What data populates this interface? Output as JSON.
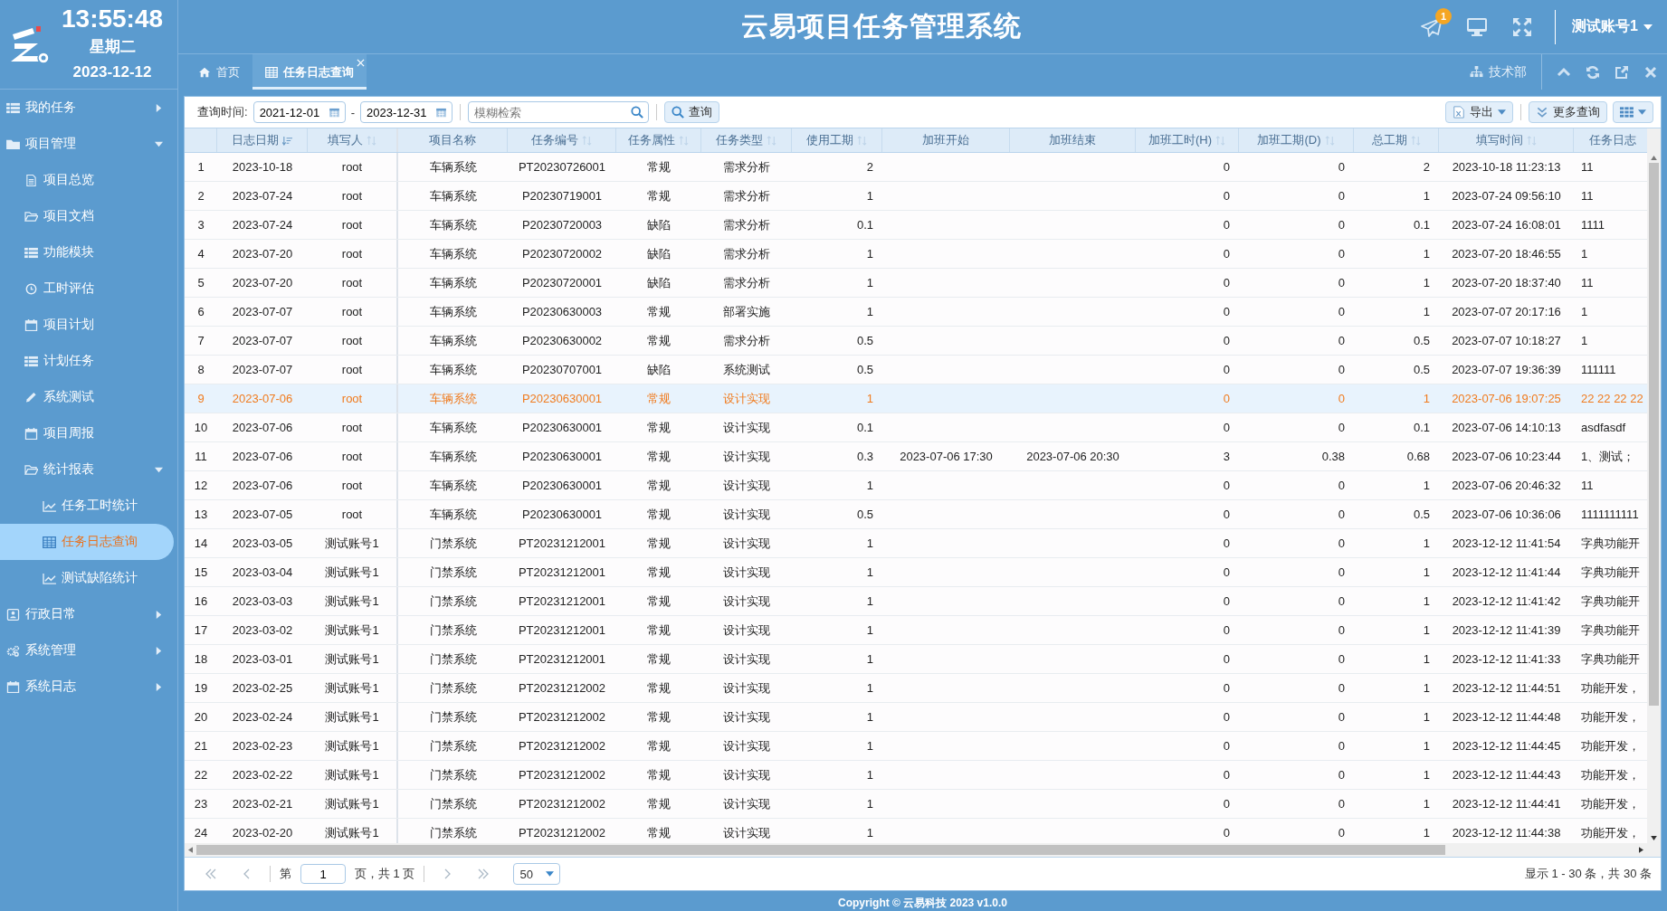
{
  "header": {
    "time": "13:55:48",
    "weekday": "星期二",
    "date": "2023-12-12",
    "title": "云易项目任务管理系统",
    "notification_count": "1",
    "user": "测试账号1"
  },
  "sidebar": {
    "items": [
      {
        "label": "我的任务",
        "expanded": false
      },
      {
        "label": "项目管理",
        "expanded": true,
        "children": [
          {
            "label": "项目总览",
            "selected": false
          },
          {
            "label": "项目文档",
            "selected": false
          },
          {
            "label": "功能模块",
            "selected": false
          },
          {
            "label": "工时评估",
            "selected": false
          },
          {
            "label": "项目计划",
            "selected": false
          },
          {
            "label": "计划任务",
            "selected": false
          },
          {
            "label": "系统测试",
            "selected": false
          },
          {
            "label": "项目周报",
            "selected": false
          },
          {
            "label": "统计报表",
            "expanded": true,
            "children": [
              {
                "label": "任务工时统计",
                "selected": false
              },
              {
                "label": "任务日志查询",
                "selected": true
              },
              {
                "label": "测试缺陷统计",
                "selected": false
              }
            ]
          }
        ]
      },
      {
        "label": "行政日常",
        "expanded": false
      },
      {
        "label": "系统管理",
        "expanded": false
      },
      {
        "label": "系统日志",
        "expanded": false
      }
    ]
  },
  "tabs": [
    {
      "label": "首页",
      "selected": false,
      "closable": false
    },
    {
      "label": "任务日志查询",
      "selected": true,
      "closable": true
    }
  ],
  "department": "技术部",
  "toolbar": {
    "time_label": "查询时间:",
    "date_from": "2021-12-01",
    "separator": "-",
    "date_to": "2023-12-31",
    "search_placeholder": "模糊检索",
    "search_button": "查询",
    "export_button": "导出",
    "more_button": "更多查询"
  },
  "table": {
    "columns": [
      {
        "sortable": false,
        "sorted": false
      },
      {
        "label": "日志日期",
        "sortable": true,
        "sorted": true
      },
      {
        "label": "填写人",
        "sortable": true,
        "sorted": false
      },
      {
        "label": "项目名称",
        "sortable": false,
        "sorted": false
      },
      {
        "label": "任务编号",
        "sortable": true,
        "sorted": false
      },
      {
        "label": "任务属性",
        "sortable": true,
        "sorted": false
      },
      {
        "label": "任务类型",
        "sortable": true,
        "sorted": false
      },
      {
        "label": "使用工期",
        "sortable": true,
        "sorted": false
      },
      {
        "label": "加班开始",
        "sortable": false,
        "sorted": false
      },
      {
        "label": "加班结束",
        "sortable": false,
        "sorted": false
      },
      {
        "label": "加班工时(H)",
        "sortable": true,
        "sorted": false
      },
      {
        "label": "加班工期(D)",
        "sortable": true,
        "sorted": false
      },
      {
        "label": "总工期",
        "sortable": true,
        "sorted": false
      },
      {
        "label": "填写时间",
        "sortable": true,
        "sorted": false
      },
      {
        "label": "任务日志",
        "sortable": false,
        "sorted": false
      }
    ],
    "rows": [
      {
        "selected": false,
        "cells": [
          "1",
          "2023-10-18",
          "root",
          "车辆系统",
          "PT20230726001",
          "常规",
          "需求分析",
          "2",
          "",
          "",
          "0",
          "0",
          "2",
          "2023-10-18 11:23:13",
          "11"
        ]
      },
      {
        "selected": false,
        "cells": [
          "2",
          "2023-07-24",
          "root",
          "车辆系统",
          "P20230719001",
          "常规",
          "需求分析",
          "1",
          "",
          "",
          "0",
          "0",
          "1",
          "2023-07-24 09:56:10",
          "11"
        ]
      },
      {
        "selected": false,
        "cells": [
          "3",
          "2023-07-24",
          "root",
          "车辆系统",
          "P20230720003",
          "缺陷",
          "需求分析",
          "0.1",
          "",
          "",
          "0",
          "0",
          "0.1",
          "2023-07-24 16:08:01",
          "1111"
        ]
      },
      {
        "selected": false,
        "cells": [
          "4",
          "2023-07-20",
          "root",
          "车辆系统",
          "P20230720002",
          "缺陷",
          "需求分析",
          "1",
          "",
          "",
          "0",
          "0",
          "1",
          "2023-07-20 18:46:55",
          "1"
        ]
      },
      {
        "selected": false,
        "cells": [
          "5",
          "2023-07-20",
          "root",
          "车辆系统",
          "P20230720001",
          "缺陷",
          "需求分析",
          "1",
          "",
          "",
          "0",
          "0",
          "1",
          "2023-07-20 18:37:40",
          "11"
        ]
      },
      {
        "selected": false,
        "cells": [
          "6",
          "2023-07-07",
          "root",
          "车辆系统",
          "P20230630003",
          "常规",
          "部署实施",
          "1",
          "",
          "",
          "0",
          "0",
          "1",
          "2023-07-07 20:17:16",
          "1"
        ]
      },
      {
        "selected": false,
        "cells": [
          "7",
          "2023-07-07",
          "root",
          "车辆系统",
          "P20230630002",
          "常规",
          "需求分析",
          "0.5",
          "",
          "",
          "0",
          "0",
          "0.5",
          "2023-07-07 10:18:27",
          "1"
        ]
      },
      {
        "selected": false,
        "cells": [
          "8",
          "2023-07-07",
          "root",
          "车辆系统",
          "P20230707001",
          "缺陷",
          "系统测试",
          "0.5",
          "",
          "",
          "0",
          "0",
          "0.5",
          "2023-07-07 19:36:39",
          "111111"
        ]
      },
      {
        "selected": true,
        "cells": [
          "9",
          "2023-07-06",
          "root",
          "车辆系统",
          "P20230630001",
          "常规",
          "设计实现",
          "1",
          "",
          "",
          "0",
          "0",
          "1",
          "2023-07-06 19:07:25",
          "22 22 22 22"
        ]
      },
      {
        "selected": false,
        "cells": [
          "10",
          "2023-07-06",
          "root",
          "车辆系统",
          "P20230630001",
          "常规",
          "设计实现",
          "0.1",
          "",
          "",
          "0",
          "0",
          "0.1",
          "2023-07-06 14:10:13",
          "asdfasdf"
        ]
      },
      {
        "selected": false,
        "cells": [
          "11",
          "2023-07-06",
          "root",
          "车辆系统",
          "P20230630001",
          "常规",
          "设计实现",
          "0.3",
          "2023-07-06 17:30",
          "2023-07-06 20:30",
          "3",
          "0.38",
          "0.68",
          "2023-07-06 10:23:44",
          "1、测试；"
        ]
      },
      {
        "selected": false,
        "cells": [
          "12",
          "2023-07-06",
          "root",
          "车辆系统",
          "P20230630001",
          "常规",
          "设计实现",
          "1",
          "",
          "",
          "0",
          "0",
          "1",
          "2023-07-06 20:46:32",
          "11"
        ]
      },
      {
        "selected": false,
        "cells": [
          "13",
          "2023-07-05",
          "root",
          "车辆系统",
          "P20230630001",
          "常规",
          "设计实现",
          "0.5",
          "",
          "",
          "0",
          "0",
          "0.5",
          "2023-07-06 10:36:06",
          "1111111111"
        ]
      },
      {
        "selected": false,
        "cells": [
          "14",
          "2023-03-05",
          "测试账号1",
          "门禁系统",
          "PT20231212001",
          "常规",
          "设计实现",
          "1",
          "",
          "",
          "0",
          "0",
          "1",
          "2023-12-12 11:41:54",
          "字典功能开"
        ]
      },
      {
        "selected": false,
        "cells": [
          "15",
          "2023-03-04",
          "测试账号1",
          "门禁系统",
          "PT20231212001",
          "常规",
          "设计实现",
          "1",
          "",
          "",
          "0",
          "0",
          "1",
          "2023-12-12 11:41:44",
          "字典功能开"
        ]
      },
      {
        "selected": false,
        "cells": [
          "16",
          "2023-03-03",
          "测试账号1",
          "门禁系统",
          "PT20231212001",
          "常规",
          "设计实现",
          "1",
          "",
          "",
          "0",
          "0",
          "1",
          "2023-12-12 11:41:42",
          "字典功能开"
        ]
      },
      {
        "selected": false,
        "cells": [
          "17",
          "2023-03-02",
          "测试账号1",
          "门禁系统",
          "PT20231212001",
          "常规",
          "设计实现",
          "1",
          "",
          "",
          "0",
          "0",
          "1",
          "2023-12-12 11:41:39",
          "字典功能开"
        ]
      },
      {
        "selected": false,
        "cells": [
          "18",
          "2023-03-01",
          "测试账号1",
          "门禁系统",
          "PT20231212001",
          "常规",
          "设计实现",
          "1",
          "",
          "",
          "0",
          "0",
          "1",
          "2023-12-12 11:41:33",
          "字典功能开"
        ]
      },
      {
        "selected": false,
        "cells": [
          "19",
          "2023-02-25",
          "测试账号1",
          "门禁系统",
          "PT20231212002",
          "常规",
          "设计实现",
          "1",
          "",
          "",
          "0",
          "0",
          "1",
          "2023-12-12 11:44:51",
          "功能开发，"
        ]
      },
      {
        "selected": false,
        "cells": [
          "20",
          "2023-02-24",
          "测试账号1",
          "门禁系统",
          "PT20231212002",
          "常规",
          "设计实现",
          "1",
          "",
          "",
          "0",
          "0",
          "1",
          "2023-12-12 11:44:48",
          "功能开发，"
        ]
      },
      {
        "selected": false,
        "cells": [
          "21",
          "2023-02-23",
          "测试账号1",
          "门禁系统",
          "PT20231212002",
          "常规",
          "设计实现",
          "1",
          "",
          "",
          "0",
          "0",
          "1",
          "2023-12-12 11:44:45",
          "功能开发，"
        ]
      },
      {
        "selected": false,
        "cells": [
          "22",
          "2023-02-22",
          "测试账号1",
          "门禁系统",
          "PT20231212002",
          "常规",
          "设计实现",
          "1",
          "",
          "",
          "0",
          "0",
          "1",
          "2023-12-12 11:44:43",
          "功能开发，"
        ]
      },
      {
        "selected": false,
        "cells": [
          "23",
          "2023-02-21",
          "测试账号1",
          "门禁系统",
          "PT20231212002",
          "常规",
          "设计实现",
          "1",
          "",
          "",
          "0",
          "0",
          "1",
          "2023-12-12 11:44:41",
          "功能开发，"
        ]
      },
      {
        "selected": false,
        "cells": [
          "24",
          "2023-02-20",
          "测试账号1",
          "门禁系统",
          "PT20231212002",
          "常规",
          "设计实现",
          "1",
          "",
          "",
          "0",
          "0",
          "1",
          "2023-12-12 11:44:38",
          "功能开发，"
        ]
      }
    ]
  },
  "pager": {
    "page_prefix": "第",
    "page": "1",
    "page_suffix": "页，共 1 页",
    "page_size": "50",
    "summary": "显示 1 - 30 条，共 30 条"
  },
  "footer": "Copyright © 云易科技 2023 v1.0.0"
}
